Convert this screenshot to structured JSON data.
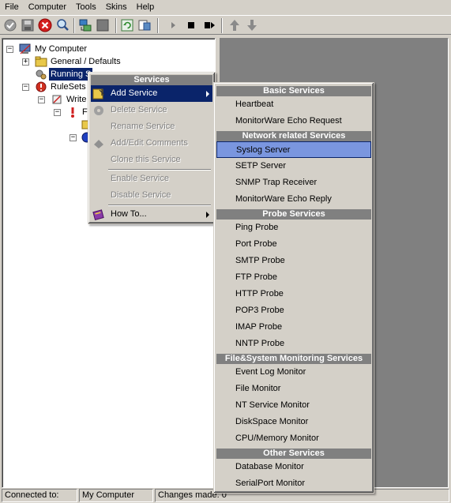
{
  "menubar": {
    "items": [
      "File",
      "Computer",
      "Tools",
      "Skins",
      "Help"
    ]
  },
  "toolbar": {
    "buttons": [
      "check-icon",
      "save-icon",
      "stop-red-icon",
      "search-icon",
      "network-icon",
      "blank-icon",
      "refresh-icon",
      "settings-icon",
      "play-icon",
      "stop-icon",
      "step-icon",
      "up-arrow-icon",
      "down-arrow-icon"
    ]
  },
  "tree": {
    "root": "My Computer",
    "general": "General / Defaults",
    "running": "Running S",
    "rulesets": "RuleSets",
    "write": "Write",
    "fi": "Fi"
  },
  "context_menu": {
    "header": "Services",
    "items": [
      {
        "label": "Add Service",
        "enabled": true
      },
      {
        "label": "Delete Service",
        "enabled": false
      },
      {
        "label": "Rename Service",
        "enabled": false
      },
      {
        "label": "Add/Edit Comments",
        "enabled": false
      },
      {
        "label": "Clone this Service",
        "enabled": false
      },
      {
        "label": "Enable Service",
        "enabled": false
      },
      {
        "label": "Disable Service",
        "enabled": false
      },
      {
        "label": "How To...",
        "enabled": true
      }
    ]
  },
  "submenu": {
    "basic_header": "Basic Services",
    "basic": [
      "Heartbeat",
      "MonitorWare Echo Request"
    ],
    "network_header": "Network related Services",
    "network": [
      "Syslog Server",
      "SETP Server",
      "SNMP Trap Receiver",
      "MonitorWare Echo Reply"
    ],
    "probe_header": "Probe Services",
    "probe": [
      "Ping Probe",
      "Port Probe",
      "SMTP Probe",
      "FTP Probe",
      "HTTP Probe",
      "POP3 Probe",
      "IMAP Probe",
      "NNTP Probe"
    ],
    "filesystem_header": "File&System Monitoring Services",
    "filesystem": [
      "Event Log Monitor",
      "File Monitor",
      "NT Service Monitor",
      "DiskSpace Monitor",
      "CPU/Memory Monitor"
    ],
    "other_header": "Other Services",
    "other": [
      "Database Monitor",
      "SerialPort Monitor"
    ]
  },
  "statusbar": {
    "connected": "Connected to:",
    "computer": "My Computer",
    "changes": "Changes made: 0"
  }
}
